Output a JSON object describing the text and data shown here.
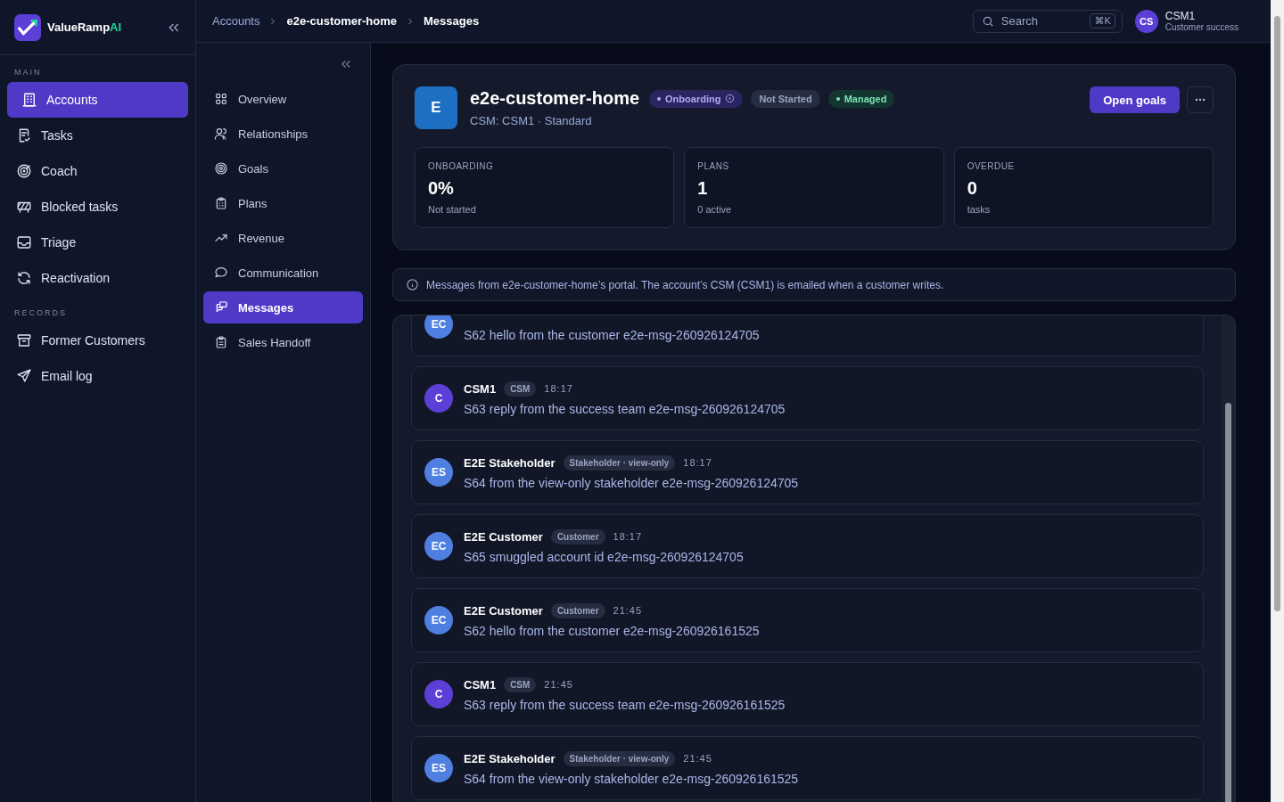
{
  "brand": {
    "name": "ValueRamp",
    "suffix": "AI"
  },
  "sidebar": {
    "sections": [
      {
        "title": "MAIN",
        "items": [
          {
            "label": "Accounts",
            "selected": true
          },
          {
            "label": "Tasks",
            "selected": false
          },
          {
            "label": "Coach",
            "selected": false
          },
          {
            "label": "Blocked tasks",
            "selected": false
          },
          {
            "label": "Triage",
            "selected": false
          },
          {
            "label": "Reactivation",
            "selected": false
          }
        ]
      },
      {
        "title": "RECORDS",
        "items": [
          {
            "label": "Former Customers",
            "selected": false
          },
          {
            "label": "Email log",
            "selected": false
          }
        ]
      }
    ]
  },
  "breadcrumb": [
    "Accounts",
    "e2e-customer-home",
    "Messages"
  ],
  "search": {
    "placeholder": "Search",
    "shortcut": "⌘K"
  },
  "user": {
    "initials": "CS",
    "name": "CSM1",
    "role": "Customer success"
  },
  "account_nav": [
    {
      "label": "Overview",
      "selected": false
    },
    {
      "label": "Relationships",
      "selected": false
    },
    {
      "label": "Goals",
      "selected": false
    },
    {
      "label": "Plans",
      "selected": false
    },
    {
      "label": "Revenue",
      "selected": false
    },
    {
      "label": "Communication",
      "selected": false
    },
    {
      "label": "Messages",
      "selected": true
    },
    {
      "label": "Sales Handoff",
      "selected": false
    }
  ],
  "account": {
    "initial": "E",
    "name": "e2e-customer-home",
    "subtitle": "CSM: CSM1 · Standard",
    "badges": [
      {
        "label": "Onboarding",
        "kind": "stage"
      },
      {
        "label": "Not Started",
        "kind": "neutral"
      },
      {
        "label": "Managed",
        "kind": "success"
      }
    ],
    "primary_action": "Open goals",
    "stats": [
      {
        "label": "ONBOARDING",
        "value": "0%",
        "caption": "Not started"
      },
      {
        "label": "PLANS",
        "value": "1",
        "caption": "0 active"
      },
      {
        "label": "OVERDUE",
        "value": "0",
        "caption": "tasks"
      }
    ]
  },
  "notice": "Messages from e2e-customer-home’s portal. The account’s CSM (CSM1) is emailed when a customer writes.",
  "messages": [
    {
      "initials": "EC",
      "kind": "customer",
      "text": "S62 hello from the customer e2e-msg-260926124705"
    },
    {
      "initials": "C",
      "kind": "csm",
      "name": "CSM1",
      "badge": "CSM",
      "time": "18:17",
      "text": "S63 reply from the success team e2e-msg-260926124705"
    },
    {
      "initials": "ES",
      "kind": "stakeholder",
      "name": "E2E Stakeholder",
      "badge": "Stakeholder · view-only",
      "time": "18:17",
      "text": "S64 from the view-only stakeholder e2e-msg-260926124705"
    },
    {
      "initials": "EC",
      "kind": "customer",
      "name": "E2E Customer",
      "badge": "Customer",
      "time": "18:17",
      "text": "S65 smuggled account id e2e-msg-260926124705"
    },
    {
      "initials": "EC",
      "kind": "customer",
      "name": "E2E Customer",
      "badge": "Customer",
      "time": "21:45",
      "text": "S62 hello from the customer e2e-msg-260926161525"
    },
    {
      "initials": "C",
      "kind": "csm",
      "name": "CSM1",
      "badge": "CSM",
      "time": "21:45",
      "text": "S63 reply from the success team e2e-msg-260926161525"
    },
    {
      "initials": "ES",
      "kind": "stakeholder",
      "name": "E2E Stakeholder",
      "badge": "Stakeholder · view-only",
      "time": "21:45",
      "text": "S64 from the view-only stakeholder e2e-msg-260926161525"
    }
  ]
}
